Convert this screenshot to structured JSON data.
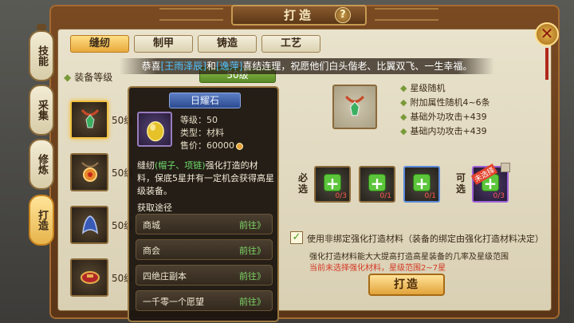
{
  "window": {
    "title": "打造",
    "help_symbol": "?",
    "close_symbol": "✕"
  },
  "side_tabs": [
    {
      "label": "技能"
    },
    {
      "label": "采集"
    },
    {
      "label": "修炼"
    },
    {
      "label": "打造"
    }
  ],
  "top_tabs": [
    {
      "label": "缝纫"
    },
    {
      "label": "制甲"
    },
    {
      "label": "铸造"
    },
    {
      "label": "工艺"
    }
  ],
  "marquee": {
    "prefix": "恭喜",
    "name1": "[王雨泽辰]",
    "and": "和",
    "name2": "[逸萍]",
    "suffix": "喜结连理，祝愿他们白头偕老、比翼双飞、一生幸福。"
  },
  "filter": {
    "label": "装备等级",
    "value": "50级"
  },
  "equipment_list": [
    {
      "level": "50级",
      "icon": "necklace-icon"
    },
    {
      "level": "50级",
      "icon": "amulet-icon"
    },
    {
      "level": "50级",
      "icon": "helmet-icon"
    },
    {
      "level": "50级",
      "icon": "headband-icon"
    }
  ],
  "tooltip": {
    "title": "日耀石",
    "level_label": "等级：50",
    "type_label": "类型：材料",
    "price_label": "售价：60000",
    "desc_prefix": "缝纫",
    "desc_highlight": "(帽子、项链)",
    "desc_suffix": "强化打造的材料，保底5星并有一定机会获得高星级装备。",
    "sources_label": "获取途径",
    "sources": [
      {
        "name": "商城",
        "action": "前往》"
      },
      {
        "name": "商会",
        "action": "前往》"
      },
      {
        "name": "四绝庄副本",
        "action": "前往》"
      },
      {
        "name": "一千零一个愿望",
        "action": "前往》"
      }
    ]
  },
  "detail": {
    "attributes": [
      "星级随机",
      "附加属性随机4~6条",
      "基础外功攻击+439",
      "基础内功攻击+439"
    ],
    "required_label": "必选",
    "optional_label": "可选",
    "materials": [
      {
        "count": "0/3"
      },
      {
        "count": "0/1"
      },
      {
        "count": "0/1"
      }
    ],
    "optional_material": {
      "count": "0/3",
      "badge": "未选择"
    },
    "checkbox_label": "使用非绑定强化打造材料（装备的绑定由强化打造材料决定）",
    "hint1": "强化打造材料能大大提高打造高星装备的几率及星级范围",
    "hint2": "当前未选择强化材料，星级范围2~7星",
    "forge_button": "打造"
  },
  "colors": {
    "accent_gold": "#e8a93a",
    "highlight_blue": "#4fc3ff",
    "warning_red": "#d63a26",
    "go_green": "#7fd86a"
  }
}
